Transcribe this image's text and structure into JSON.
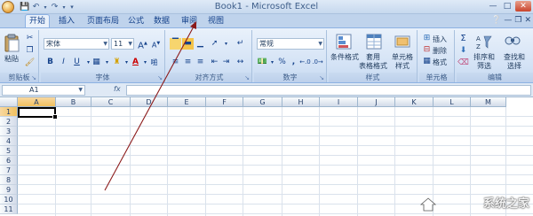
{
  "window": {
    "title": "Book1 - Microsoft Excel"
  },
  "tabs": [
    {
      "label": "开始",
      "active": true
    },
    {
      "label": "插入",
      "active": false
    },
    {
      "label": "页面布局",
      "active": false
    },
    {
      "label": "公式",
      "active": false
    },
    {
      "label": "数据",
      "active": false
    },
    {
      "label": "审阅",
      "active": false
    },
    {
      "label": "视图",
      "active": false
    }
  ],
  "ribbon": {
    "clipboard": {
      "label": "剪贴板",
      "paste_label": "粘贴"
    },
    "font": {
      "label": "字体",
      "font_name": "宋体",
      "font_size": "11",
      "bold": "B",
      "italic": "I",
      "underline": "U"
    },
    "alignment": {
      "label": "对齐方式"
    },
    "number": {
      "label": "数字",
      "format": "常规"
    },
    "styles": {
      "label": "样式",
      "conditional_format": "条件格式",
      "table_format": "套用\n表格格式",
      "cell_styles": "单元格\n样式"
    },
    "cells": {
      "label": "单元格",
      "insert": "插入",
      "delete": "删除",
      "format": "格式"
    },
    "editing": {
      "label": "编辑",
      "sort_filter": "排序和\n筛选",
      "find_select": "查找和\n选择"
    }
  },
  "formula_bar": {
    "name_box": "A1",
    "fx_label": "fx",
    "formula": ""
  },
  "grid": {
    "columns": [
      "A",
      "B",
      "C",
      "D",
      "E",
      "F",
      "G",
      "H",
      "I",
      "J",
      "K",
      "L",
      "M"
    ],
    "rows": [
      "1",
      "2",
      "3",
      "4",
      "5",
      "6",
      "7",
      "8",
      "9",
      "10",
      "11"
    ],
    "selected_cell": "A1"
  },
  "watermark": {
    "text": "系统之家"
  },
  "colors": {
    "accent": "#15428b",
    "annotation_arrow": "#8b1a1a",
    "selection": "#f1c15f"
  }
}
